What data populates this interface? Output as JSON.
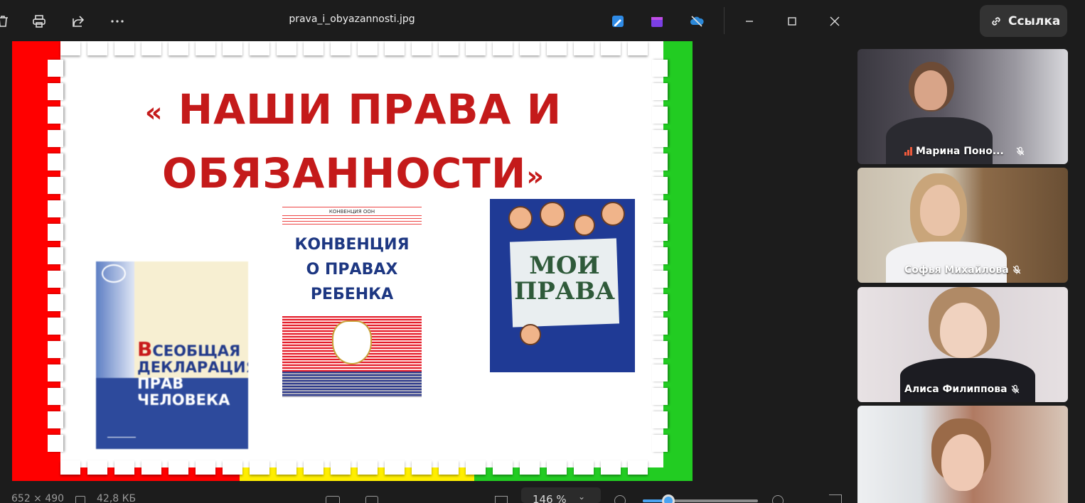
{
  "viewer": {
    "title": "prava_i_obyazannosti.jpg",
    "image": {
      "headline_line1": "НАШИ ПРАВА И",
      "headline_line2": "ОБЯЗАННОСТИ",
      "quote_open": "«",
      "quote_close": "»",
      "book1": {
        "cap": "В",
        "line1_rest": "СЕОБЩАЯ",
        "line2": "ДЕКЛАРАЦИЯ",
        "line3": "ПРАВ",
        "line4": "ЧЕЛОВЕКА"
      },
      "book2": {
        "small": "КОНВЕНЦИЯ ООН",
        "line1": "КОНВЕНЦИЯ",
        "line2": "О ПРАВАХ",
        "line3": "РЕБЕНКА"
      },
      "book3": {
        "line1": "МОИ",
        "line2": "ПРАВА"
      },
      "colors": {
        "red": "#ff0000",
        "yellow": "#ffee00",
        "green": "#22cc22",
        "headline": "#c41a1a"
      }
    },
    "status": {
      "dimensions": "652 × 490",
      "size": "42,8 КБ",
      "zoom": "146 %",
      "zoom_level": 0.22
    }
  },
  "panel": {
    "link_label": "Ссылка",
    "participants": [
      {
        "name": "Марина Поно...",
        "speaking": true,
        "muted": true
      },
      {
        "name": "Софья Михайлова",
        "speaking": false,
        "muted": true
      },
      {
        "name": "Алиса Филиппова",
        "speaking": false,
        "muted": true
      },
      {
        "name": "",
        "speaking": false,
        "muted": false
      }
    ]
  }
}
